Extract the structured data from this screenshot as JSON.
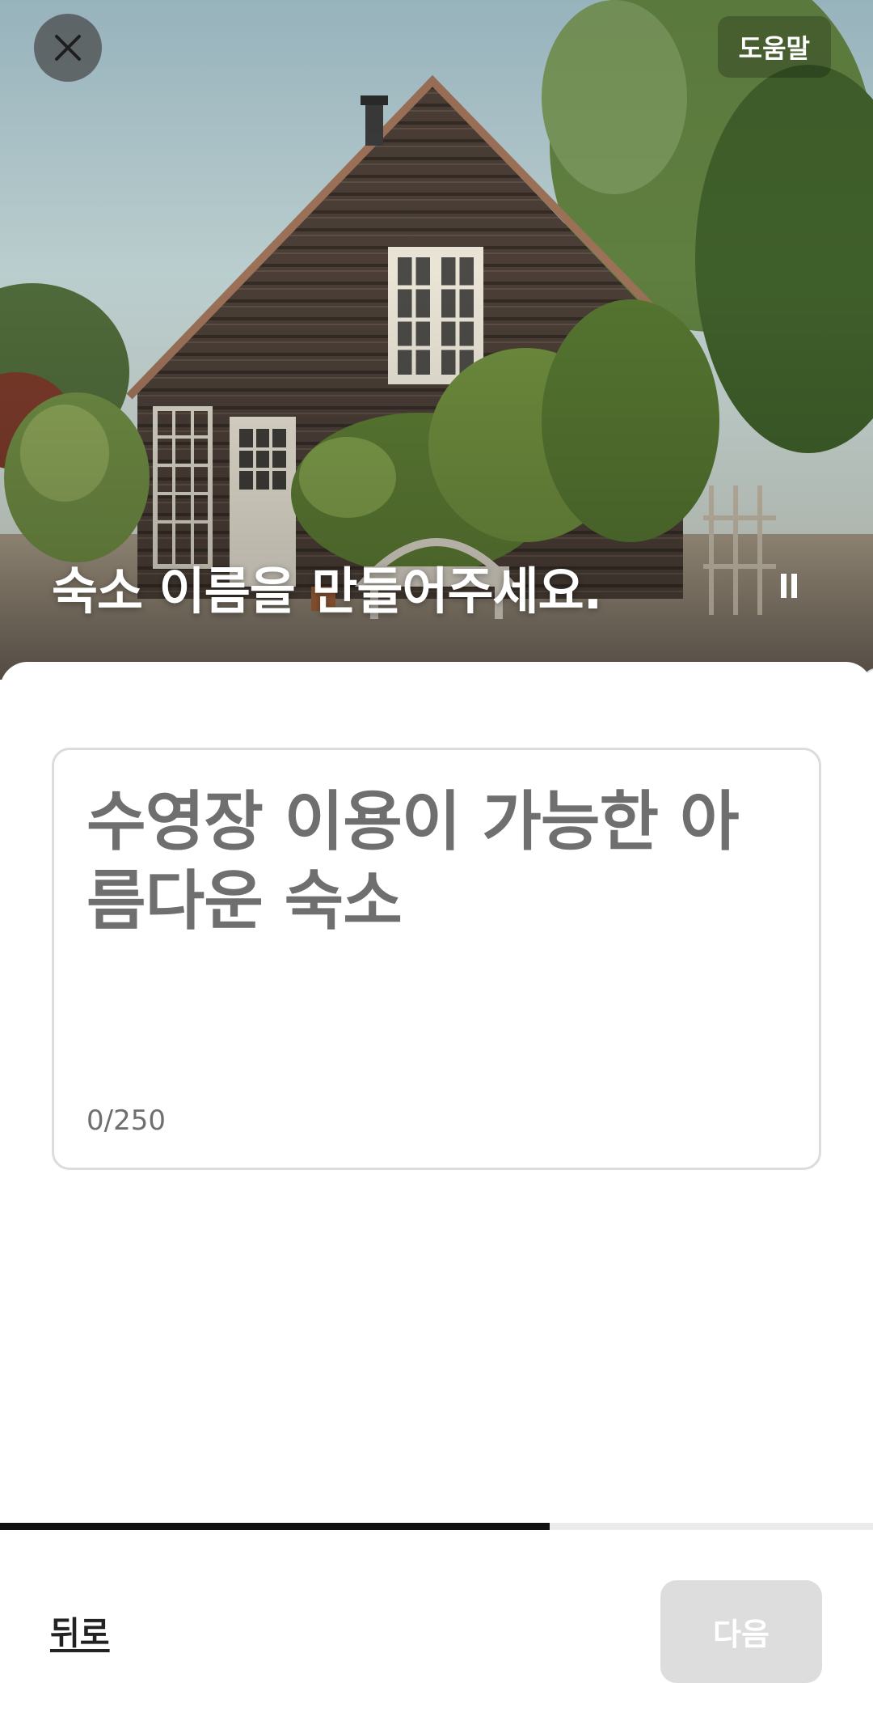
{
  "header": {
    "close_icon": "close-icon",
    "help_label": "도움말"
  },
  "hero": {
    "title": "숙소 이름을 만들어주세요.",
    "pause_icon": "pause-icon"
  },
  "listing_name": {
    "value": "",
    "placeholder": "수영장 이용이 가능한 아름다운 숙소",
    "char_count": "0/250"
  },
  "progress": {
    "fraction": 0.63
  },
  "footer": {
    "back_label": "뒤로",
    "next_label": "다음"
  },
  "colors": {
    "accent": "#222222",
    "disabled_button": "#dddddd",
    "progress_fill": "#111111",
    "progress_track": "#ebebeb"
  }
}
